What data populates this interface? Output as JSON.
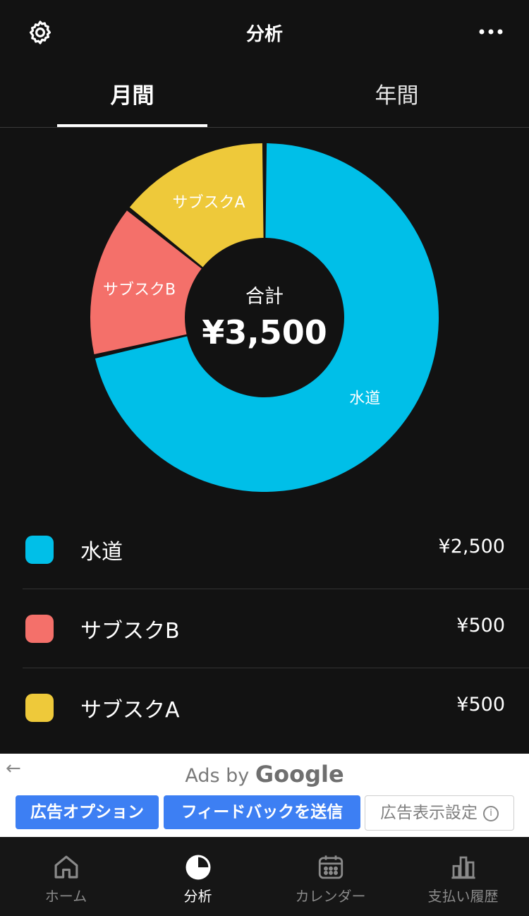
{
  "header": {
    "title": "分析",
    "settings_icon": "gear-icon",
    "more_icon": "more-horizontal-icon"
  },
  "tabs": [
    {
      "label": "月間",
      "active": true
    },
    {
      "label": "年間",
      "active": false
    }
  ],
  "chart_data": {
    "type": "pie",
    "donut": true,
    "center_label": "合計",
    "center_value": "¥3,500",
    "series": [
      {
        "name": "水道",
        "value": 2500,
        "color": "#00BFE8"
      },
      {
        "name": "サブスクB",
        "value": 500,
        "color": "#F4706A"
      },
      {
        "name": "サブスクA",
        "value": 500,
        "color": "#EEC93A"
      }
    ]
  },
  "legend": [
    {
      "name": "水道",
      "amount": "¥2,500",
      "color": "#00BFE8"
    },
    {
      "name": "サブスクB",
      "amount": "¥500",
      "color": "#F4706A"
    },
    {
      "name": "サブスクA",
      "amount": "¥500",
      "color": "#EEC93A"
    }
  ],
  "ad": {
    "back_icon": "arrow-left-icon",
    "ads_by": "Ads by",
    "brand": "Google",
    "buttons": [
      "広告オプション",
      "フィードバックを送信",
      "広告表示設定"
    ],
    "info_icon": "info-icon"
  },
  "nav": [
    {
      "label": "ホーム",
      "icon": "home-icon",
      "active": false
    },
    {
      "label": "分析",
      "icon": "pie-chart-icon",
      "active": true
    },
    {
      "label": "カレンダー",
      "icon": "calendar-icon",
      "active": false
    },
    {
      "label": "支払い履歴",
      "icon": "bar-chart-icon",
      "active": false
    }
  ],
  "colors": {
    "background": "#121212",
    "ad_button": "#3D7FF3"
  }
}
